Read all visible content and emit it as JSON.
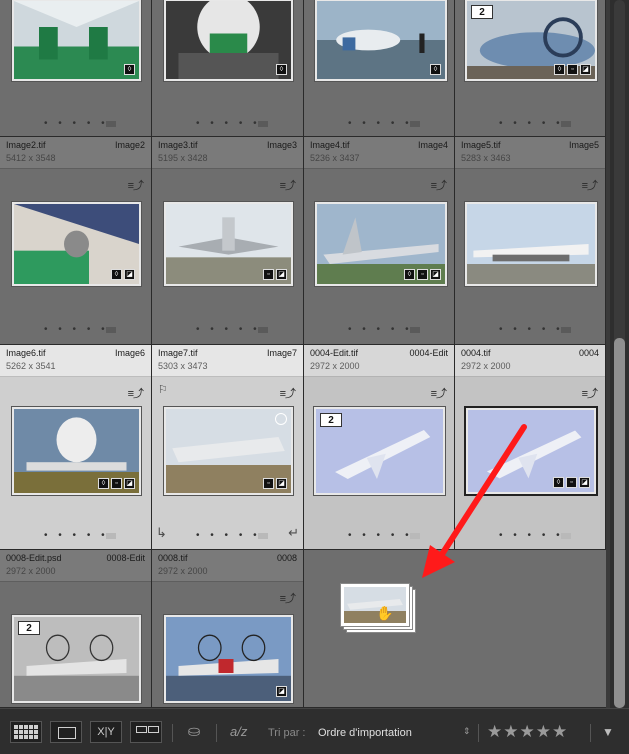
{
  "grid": {
    "row1": [
      {
        "fname": "Image2.tif",
        "fidx": "Image2",
        "fdim": "5412 x 3548"
      },
      {
        "fname": "Image3.tif",
        "fidx": "Image3",
        "fdim": "5195 x 3428"
      },
      {
        "fname": "Image4.tif",
        "fidx": "Image4",
        "fdim": "5236 x 3437"
      },
      {
        "fname": "Image5.tif",
        "fidx": "Image5",
        "fdim": "5283 x 3463"
      }
    ],
    "row2": [
      {
        "fname": "Image6.tif",
        "fidx": "Image6",
        "fdim": "5262 x 3541"
      },
      {
        "fname": "Image7.tif",
        "fidx": "Image7",
        "fdim": "5303 x 3473"
      },
      {
        "fname": "0004-Edit.tif",
        "fidx": "0004-Edit",
        "fdim": "2972 x 2000"
      },
      {
        "fname": "0004.tif",
        "fidx": "0004",
        "fdim": "2972 x 2000"
      }
    ],
    "row3": [
      {
        "fname": "0008-Edit.psd",
        "fidx": "0008-Edit",
        "fdim": "2972 x 2000"
      },
      {
        "fname": "0008.tif",
        "fidx": "0008",
        "fdim": "2972 x 2000"
      }
    ],
    "stack_counts": {
      "image5": "2",
      "edit0004": "2",
      "edit0008": "2"
    },
    "dots": "• • • • •",
    "badge_icon": "≡⤴",
    "flag_icon": "⚐"
  },
  "toolbar": {
    "sort_label": "Tri par :",
    "sort_value": "Ordre d'importation",
    "sort_arrow": "⇕",
    "xy_label": "X|Y",
    "az_label": "a/z",
    "stars": "★★★★★",
    "menu_arrow": "▼",
    "icons": [
      "grid-view-icon",
      "loupe-view-icon",
      "compare-view-icon",
      "survey-view-icon",
      "spray-can-icon",
      "sort-direction-icon"
    ]
  },
  "colors": {
    "annotation_arrow": "#ff1a1a",
    "accent": "#cfcfcf"
  }
}
